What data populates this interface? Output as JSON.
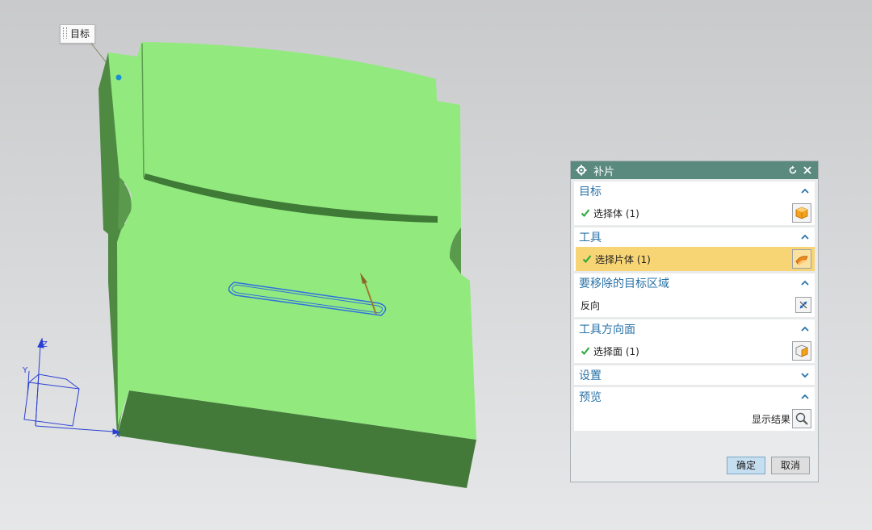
{
  "viewport": {
    "target_tag": "目标",
    "axes": {
      "z": "Z",
      "y": "Y",
      "x": "X"
    },
    "colors": {
      "model_top": "#92ea7e",
      "model_side": "#4f8a43",
      "model_front": "#437a3a",
      "curve": "#2f6fe0"
    }
  },
  "dialog": {
    "title": "补片",
    "sections": [
      {
        "label": "目标",
        "row": "选择体 (1)",
        "icon": "solid-body-icon"
      },
      {
        "label": "工具",
        "row": "选择片体 (1)",
        "icon": "sheet-body-icon"
      },
      {
        "label": "要移除的目标区域",
        "row": "反向",
        "icon": "reverse-direction-icon"
      },
      {
        "label": "工具方向面",
        "row": "选择面 (1)",
        "icon": "face-select-icon"
      },
      {
        "label": "设置"
      },
      {
        "label": "预览",
        "row": "显示结果",
        "icon": "magnifier-icon"
      }
    ],
    "ok": "确定",
    "cancel": "取消"
  }
}
